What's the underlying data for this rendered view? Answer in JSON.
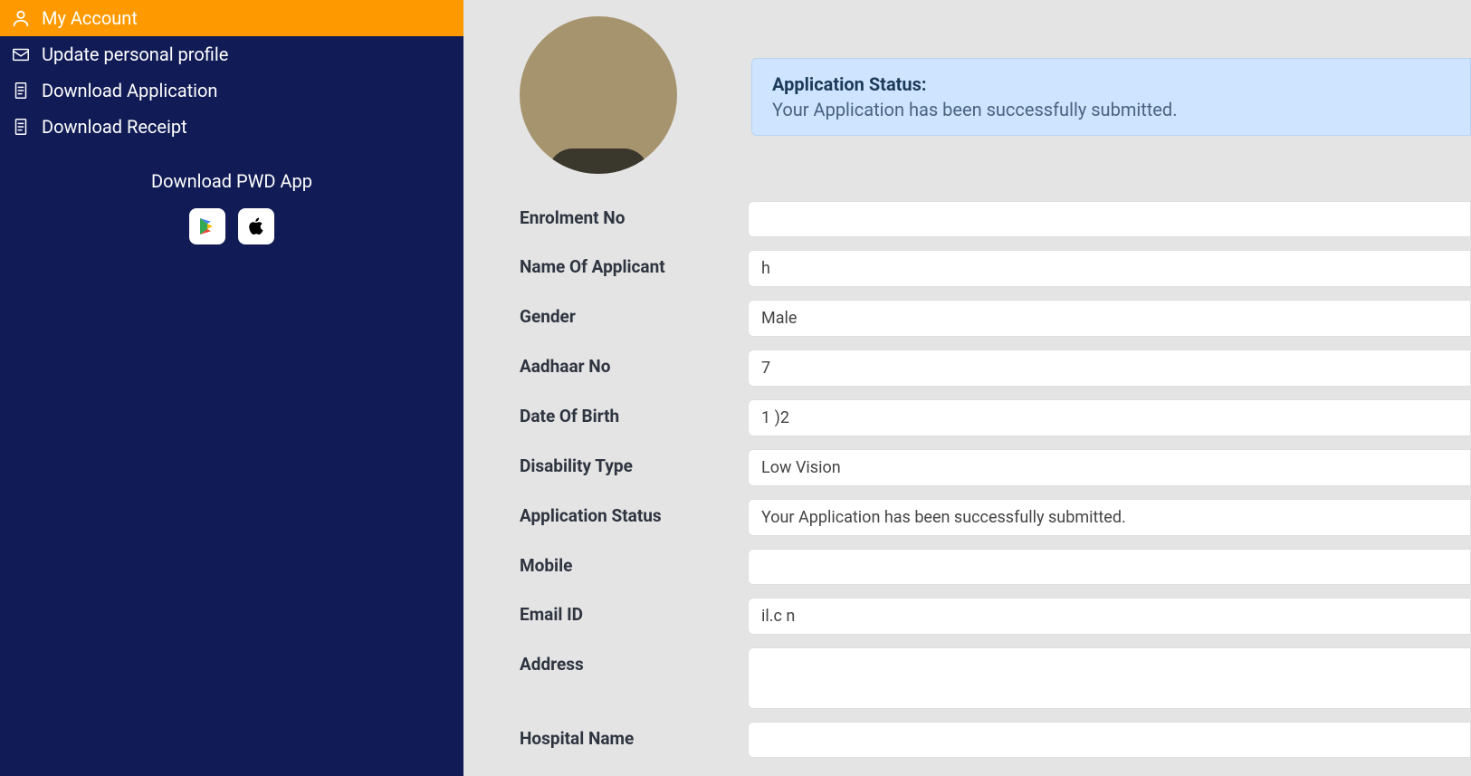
{
  "sidebar": {
    "items": [
      {
        "label": "My Account",
        "icon": "user"
      },
      {
        "label": "Update personal profile",
        "icon": "mail"
      },
      {
        "label": "Download Application",
        "icon": "document"
      },
      {
        "label": "Download Receipt",
        "icon": "document"
      }
    ],
    "download_app_label": "Download PWD App"
  },
  "status_banner": {
    "title": "Application Status:",
    "body": "Your Application has been successfully submitted."
  },
  "fields": {
    "enrolment_no": {
      "label": "Enrolment No",
      "value": ""
    },
    "name": {
      "label": "Name Of Applicant",
      "value": "h"
    },
    "gender": {
      "label": "Gender",
      "value": "Male"
    },
    "aadhaar": {
      "label": "Aadhaar No",
      "value": "7"
    },
    "dob": {
      "label": "Date Of Birth",
      "value": "1            )2"
    },
    "disability_type": {
      "label": "Disability Type",
      "value": "Low Vision"
    },
    "application_status": {
      "label": "Application Status",
      "value": "Your Application has been successfully submitted."
    },
    "mobile": {
      "label": "Mobile",
      "value": ""
    },
    "email": {
      "label": "Email ID",
      "value": "il.c   n"
    },
    "address": {
      "label": "Address",
      "value": ""
    },
    "hospital_name": {
      "label": "Hospital Name",
      "value": ""
    }
  }
}
